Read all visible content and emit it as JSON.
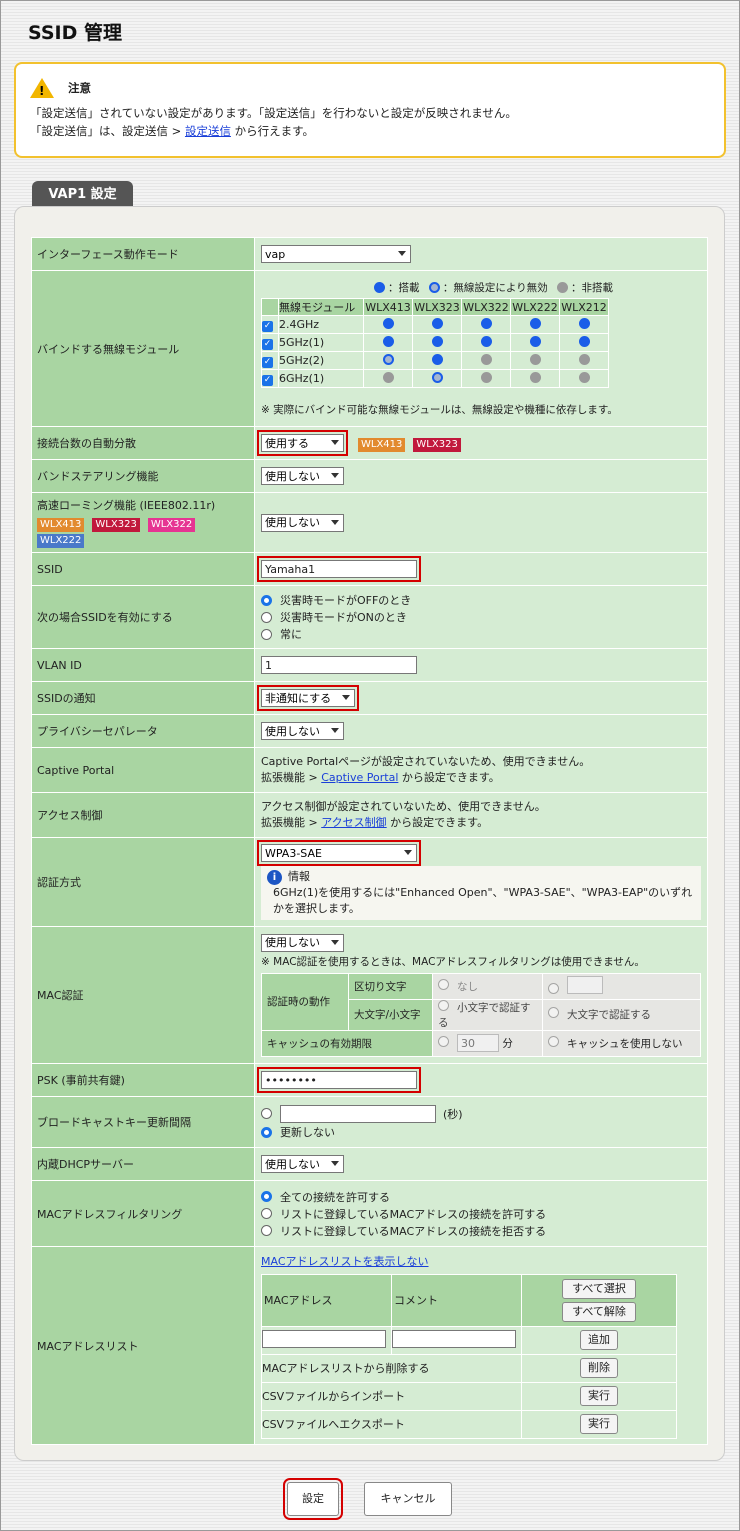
{
  "page": {
    "title": "SSID 管理"
  },
  "notice": {
    "title": "注意",
    "line1": "「設定送信」されていない設定があります。「設定送信」を行わないと設定が反映されません。",
    "line2_pre": "「設定送信」は、設定送信 > ",
    "line2_link": "設定送信",
    "line2_post": " から行えます。"
  },
  "tab": {
    "label": "VAP1 設定"
  },
  "rows": {
    "mode": {
      "label": "インターフェース動作モード",
      "value": "vap"
    },
    "bind": {
      "label": "バインドする無線モジュール",
      "legend_on": "：搭載",
      "legend_dis": "：無線設定により無効",
      "legend_off": "：非搭載",
      "col0": "無線モジュール",
      "models": [
        "WLX413",
        "WLX323",
        "WLX322",
        "WLX222",
        "WLX212"
      ],
      "bands": [
        {
          "name": "2.4GHz",
          "dots": [
            "on",
            "on",
            "on",
            "on",
            "on"
          ]
        },
        {
          "name": "5GHz(1)",
          "dots": [
            "on",
            "on",
            "on",
            "on",
            "on"
          ]
        },
        {
          "name": "5GHz(2)",
          "dots": [
            "dis",
            "on",
            "off",
            "off",
            "off"
          ]
        },
        {
          "name": "6GHz(1)",
          "dots": [
            "off",
            "dis",
            "off",
            "off",
            "off"
          ]
        }
      ],
      "note": "※ 実際にバインド可能な無線モジュールは、無線設定や機種に依存します。"
    },
    "auto": {
      "label": "接続台数の自動分散",
      "value": "使用する",
      "tags": [
        "WLX413",
        "WLX323"
      ]
    },
    "band": {
      "label": "バンドステアリング機能",
      "value": "使用しない"
    },
    "roam": {
      "label": "高速ローミング機能 (IEEE802.11r)",
      "value": "使用しない",
      "tags": [
        "WLX413",
        "WLX323",
        "WLX322",
        "WLX222"
      ]
    },
    "ssid": {
      "label": "SSID",
      "value": "Yamaha1"
    },
    "enable": {
      "label": "次の場合SSIDを有効にする",
      "options": [
        "災害時モードがOFFのとき",
        "災害時モードがONのとき",
        "常に"
      ]
    },
    "vlan": {
      "label": "VLAN ID",
      "value": "1"
    },
    "notify": {
      "label": "SSIDの通知",
      "value": "非通知にする"
    },
    "privacy": {
      "label": "プライバシーセパレータ",
      "value": "使用しない"
    },
    "captive": {
      "label": "Captive Portal",
      "line1": "Captive Portalページが設定されていないため、使用できません。",
      "pre": "拡張機能 > ",
      "link": "Captive Portal",
      "post": " から設定できます。"
    },
    "access": {
      "label": "アクセス制御",
      "line1": "アクセス制御が設定されていないため、使用できません。",
      "pre": "拡張機能 > ",
      "link": "アクセス制御",
      "post": " から設定できます。"
    },
    "auth": {
      "label": "認証方式",
      "value": "WPA3-SAE",
      "info_title": "情報",
      "info_text": "6GHz(1)を使用するには\"Enhanced Open\"、\"WPA3-SAE\"、\"WPA3-EAP\"のいずれかを選択します。"
    },
    "mac": {
      "label": "MAC認証",
      "value": "使用しない",
      "note": "※ MAC認証を使用するときは、MACアドレスフィルタリングは使用できません。",
      "auth_action": "認証時の動作",
      "sep": "区切り文字",
      "none": "なし",
      "case": "大文字/小文字",
      "lower": "小文字で認証する",
      "upper": "大文字で認証する",
      "cache": "キャッシュの有効期限",
      "cache_val": "30",
      "min": "分",
      "nocache": "キャッシュを使用しない"
    },
    "psk": {
      "label": "PSK (事前共有鍵)",
      "value": "••••••••"
    },
    "bcast": {
      "label": "ブロードキャストキー更新間隔",
      "unit": "(秒)",
      "never": "更新しない"
    },
    "dhcp": {
      "label": "内蔵DHCPサーバー",
      "value": "使用しない"
    },
    "filter": {
      "label": "MACアドレスフィルタリング",
      "options": [
        "全ての接続を許可する",
        "リストに登録しているMACアドレスの接続を許可する",
        "リストに登録しているMACアドレスの接続を拒否する"
      ]
    },
    "list": {
      "label": "MACアドレスリスト",
      "hide": "MACアドレスリストを表示しない",
      "col_mac": "MACアドレス",
      "col_comment": "コメント",
      "select_all": "すべて選択",
      "deselect_all": "すべて解除",
      "add": "追加",
      "del_label": "MACアドレスリストから削除する",
      "del": "削除",
      "imp_label": "CSVファイルからインポート",
      "exp_label": "CSVファイルへエクスポート",
      "run": "実行"
    }
  },
  "footer": {
    "submit": "設定",
    "cancel": "キャンセル"
  }
}
